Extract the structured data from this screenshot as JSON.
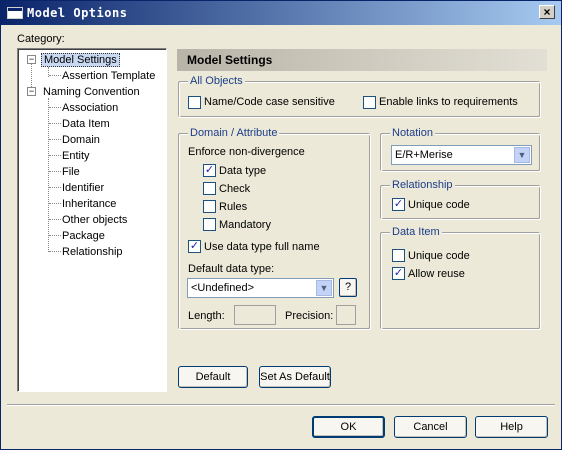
{
  "window": {
    "title": "Model Options",
    "close_label": "×"
  },
  "category": {
    "label": "Category:"
  },
  "tree": {
    "items": [
      {
        "label": "Model Settings",
        "expander": "−"
      },
      {
        "label": "Assertion Template"
      },
      {
        "label": "Naming Convention",
        "expander": "−"
      },
      {
        "label": "Association"
      },
      {
        "label": "Data Item"
      },
      {
        "label": "Domain"
      },
      {
        "label": "Entity"
      },
      {
        "label": "File"
      },
      {
        "label": "Identifier"
      },
      {
        "label": "Inheritance"
      },
      {
        "label": "Other objects"
      },
      {
        "label": "Package"
      },
      {
        "label": "Relationship"
      }
    ]
  },
  "panel": {
    "title": "Model Settings",
    "all_objects": {
      "title": "All Objects",
      "name_code_case": {
        "label": "Name/Code case sensitive",
        "checked": false
      },
      "enable_links": {
        "label": "Enable links to requirements",
        "checked": false
      }
    },
    "domain_attribute": {
      "title": "Domain / Attribute",
      "enforce_label": "Enforce non-divergence",
      "data_type": {
        "label": "Data type",
        "checked": true
      },
      "check": {
        "label": "Check",
        "checked": false
      },
      "rules": {
        "label": "Rules",
        "checked": false
      },
      "mandatory": {
        "label": "Mandatory",
        "checked": false
      },
      "use_full_name": {
        "label": "Use data type full name",
        "checked": true
      },
      "default_type_label": "Default data type:",
      "default_type_value": "<Undefined>",
      "help_btn": "?",
      "length_label": "Length:",
      "precision_label": "Precision:"
    },
    "notation": {
      "title": "Notation",
      "value": "E/R+Merise"
    },
    "relationship": {
      "title": "Relationship",
      "unique_code": {
        "label": "Unique code",
        "checked": true
      }
    },
    "data_item": {
      "title": "Data Item",
      "unique_code": {
        "label": "Unique code",
        "checked": false
      },
      "allow_reuse": {
        "label": "Allow reuse",
        "checked": true
      }
    }
  },
  "buttons": {
    "default": "Default",
    "set_as_default": "Set As Default",
    "ok": "OK",
    "cancel": "Cancel",
    "help": "Help"
  },
  "check_mark": "✓"
}
